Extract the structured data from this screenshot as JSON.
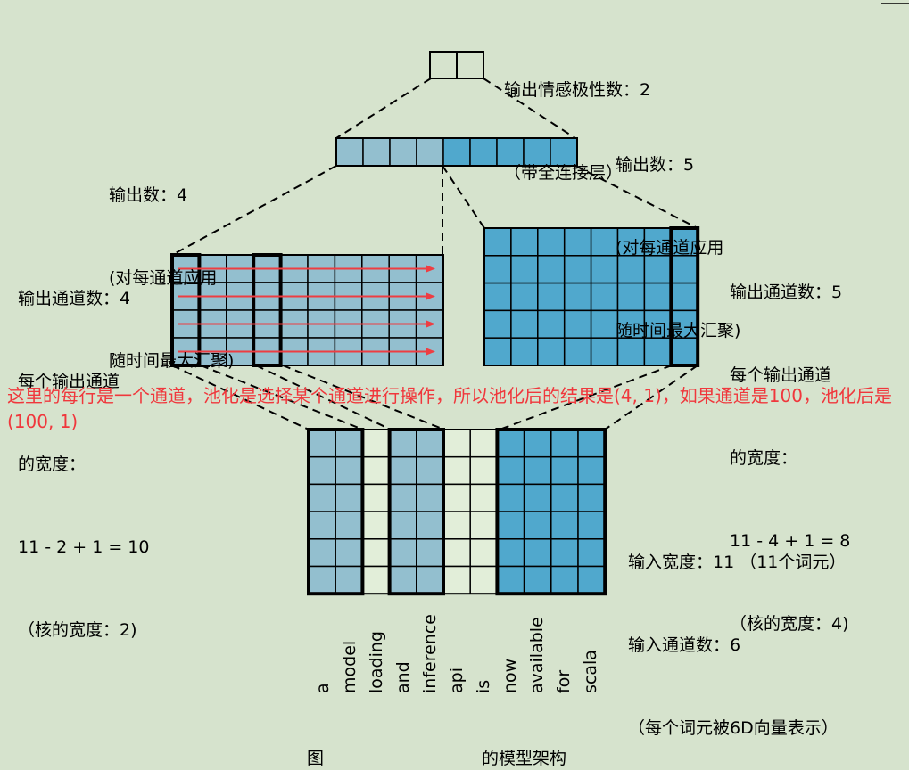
{
  "colors": {
    "background": "#d6e3cd",
    "light_blue": "#93bfcf",
    "dark_blue": "#50a8cd",
    "pale": "#e2eed9",
    "arrow_red": "#ee3d42",
    "annotation_red": "#f0373c"
  },
  "top_label": [
    "输出情感极性数：2",
    "（带全连接层）"
  ],
  "pool_left_label": [
    "输出数：4",
    "(对每通道应用",
    "随时间最大汇聚)"
  ],
  "pool_right_label": [
    "输出数：5",
    "(对每通道应用",
    "随时间最大汇聚)"
  ],
  "conv_left_label": [
    "输出通道数：4",
    "每个输出通道",
    "的宽度：",
    "11 - 2 + 1 = 10",
    "（核的宽度：2)"
  ],
  "conv_right_label": [
    "输出通道数：5",
    "每个输出通道",
    "的宽度：",
    "11 - 4 + 1 = 8",
    "（核的宽度：4)"
  ],
  "annotation": "这里的每行是一个通道，池化是选择某个通道进行操作，所以池化后的结果是(4, 1)，如果通道是100，池化后是(100, 1)",
  "input_label": [
    "输入宽度：11 （11个词元）",
    "输入通道数：6",
    "（每个词元被6D向量表示）"
  ],
  "tokens": [
    "a",
    "model",
    "loading",
    "and",
    "inference",
    "api",
    "is",
    "now",
    "available",
    "for",
    "scala"
  ],
  "caption_prefix": "图",
  "caption_suffix": "的模型架构",
  "diagram": {
    "output_units": 2,
    "pooled_left_count": 4,
    "pooled_right_count": 5,
    "conv_left": {
      "channels": 4,
      "width": 10,
      "kernel": 2
    },
    "conv_right": {
      "channels": 5,
      "width": 8,
      "kernel": 4
    },
    "input": {
      "width": 11,
      "channels": 6
    }
  }
}
